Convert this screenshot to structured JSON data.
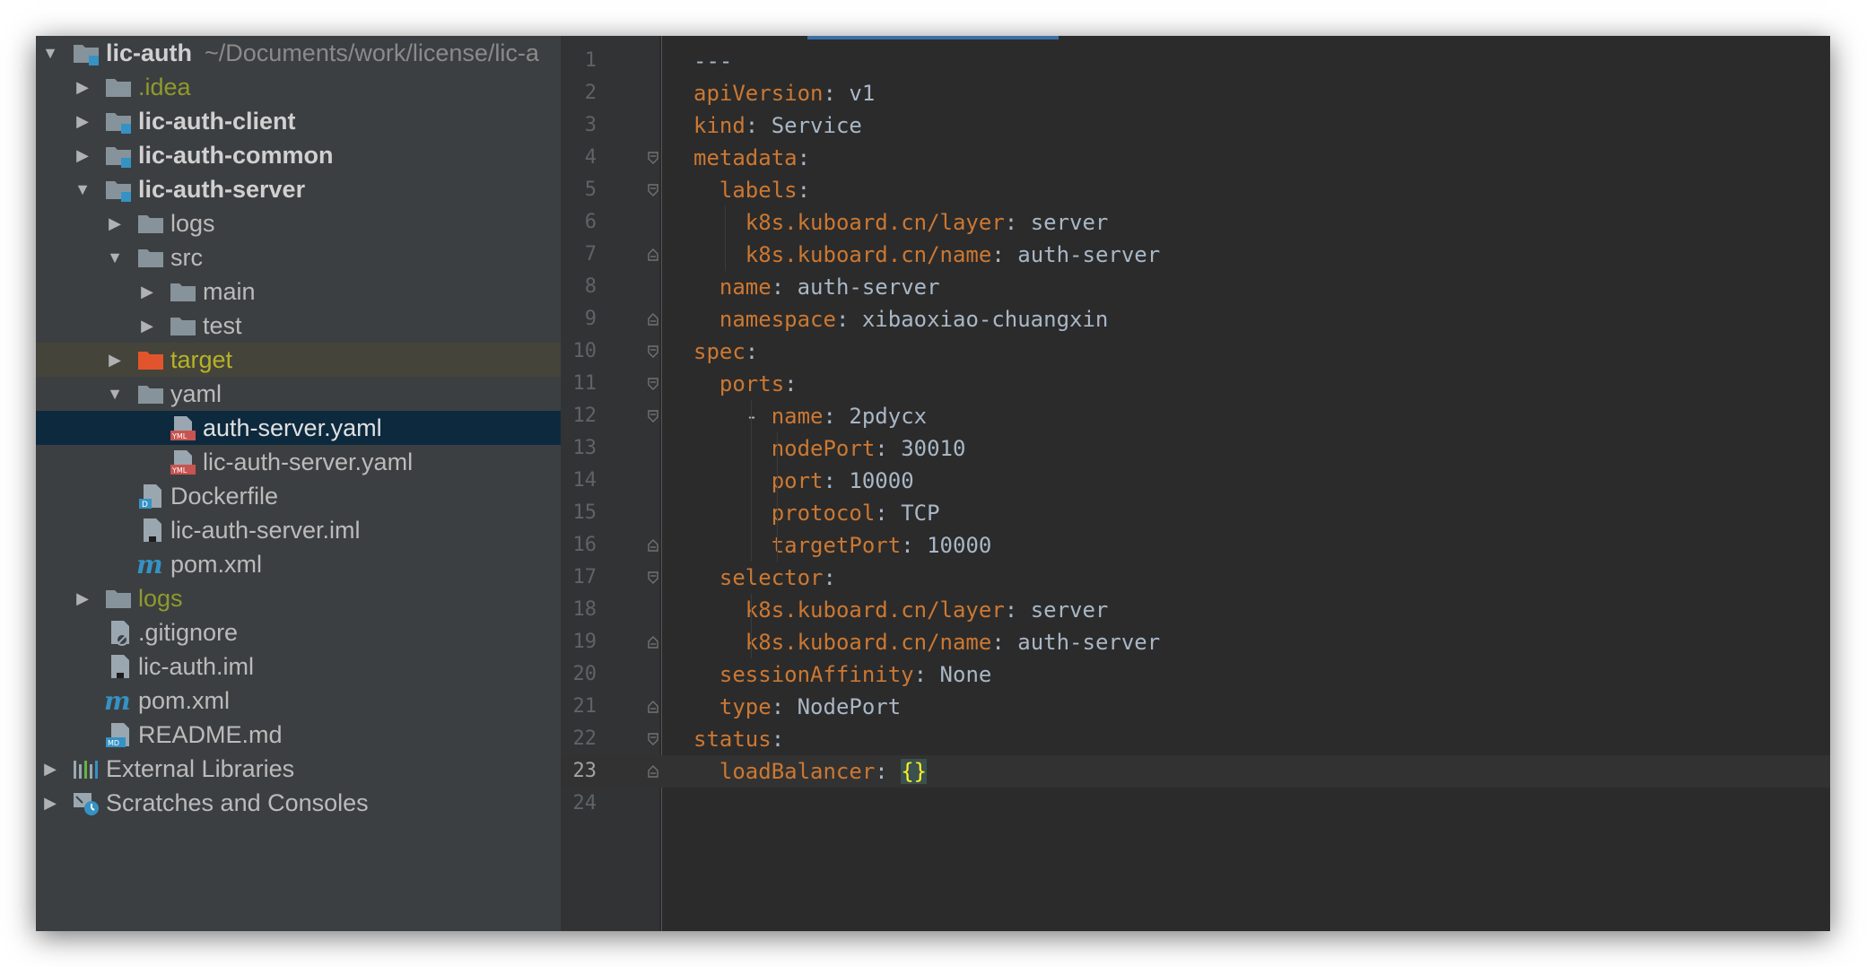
{
  "project_tree": {
    "root": {
      "label": "lic-auth",
      "path": "~/Documents/work/license/lic-a"
    },
    "items": [
      {
        "label": ".idea"
      },
      {
        "label": "lic-auth-client"
      },
      {
        "label": "lic-auth-common"
      },
      {
        "label": "lic-auth-server"
      },
      {
        "label": "logs"
      },
      {
        "label": "src"
      },
      {
        "label": "main"
      },
      {
        "label": "test"
      },
      {
        "label": "target"
      },
      {
        "label": "yaml"
      },
      {
        "label": "auth-server.yaml"
      },
      {
        "label": "lic-auth-server.yaml"
      },
      {
        "label": "Dockerfile"
      },
      {
        "label": "lic-auth-server.iml"
      },
      {
        "label": "pom.xml"
      },
      {
        "label": "logs"
      },
      {
        "label": ".gitignore"
      },
      {
        "label": "lic-auth.iml"
      },
      {
        "label": "pom.xml"
      },
      {
        "label": "README.md"
      },
      {
        "label": "External Libraries"
      },
      {
        "label": "Scratches and Consoles"
      }
    ],
    "selected": "auth-server.yaml"
  },
  "editor": {
    "current_line": 23,
    "line_numbers": [
      "1",
      "2",
      "3",
      "4",
      "5",
      "6",
      "7",
      "8",
      "9",
      "10",
      "11",
      "12",
      "13",
      "14",
      "15",
      "16",
      "17",
      "18",
      "19",
      "20",
      "21",
      "22",
      "23",
      "24"
    ],
    "lines": [
      {
        "key": "---",
        "sep": "",
        "value": ""
      },
      {
        "key": "apiVersion",
        "sep": ": ",
        "value": "v1"
      },
      {
        "key": "kind",
        "sep": ": ",
        "value": "Service"
      },
      {
        "key": "metadata",
        "sep": ":",
        "value": ""
      },
      {
        "key": "labels",
        "sep": ":",
        "value": ""
      },
      {
        "key": "k8s.kuboard.cn/layer",
        "sep": ": ",
        "value": "server"
      },
      {
        "key": "k8s.kuboard.cn/name",
        "sep": ": ",
        "value": "auth-server"
      },
      {
        "key": "name",
        "sep": ": ",
        "value": "auth-server"
      },
      {
        "key": "namespace",
        "sep": ": ",
        "value": "xibaoxiao-chuangxin"
      },
      {
        "key": "spec",
        "sep": ":",
        "value": ""
      },
      {
        "key": "ports",
        "sep": ":",
        "value": ""
      },
      {
        "dash": "- ",
        "key": "name",
        "sep": ": ",
        "value": "2pdycx"
      },
      {
        "key": "nodePort",
        "sep": ": ",
        "value": "30010"
      },
      {
        "key": "port",
        "sep": ": ",
        "value": "10000"
      },
      {
        "key": "protocol",
        "sep": ": ",
        "value": "TCP"
      },
      {
        "key": "targetPort",
        "sep": ": ",
        "value": "10000"
      },
      {
        "key": "selector",
        "sep": ":",
        "value": ""
      },
      {
        "key": "k8s.kuboard.cn/layer",
        "sep": ": ",
        "value": "server"
      },
      {
        "key": "k8s.kuboard.cn/name",
        "sep": ": ",
        "value": "auth-server"
      },
      {
        "key": "sessionAffinity",
        "sep": ": ",
        "value": "None"
      },
      {
        "key": "type",
        "sep": ": ",
        "value": "NodePort"
      },
      {
        "key": "status",
        "sep": ":",
        "value": ""
      },
      {
        "key": "loadBalancer",
        "sep": ": ",
        "value": "{}"
      },
      {
        "key": "",
        "sep": "",
        "value": ""
      }
    ]
  },
  "colors": {
    "tree_bg": "#3c3f41",
    "editor_bg": "#2b2b2b",
    "yaml_key": "#cc7832",
    "yaml_value": "#a9b7c6",
    "selection": "#0d293e"
  }
}
